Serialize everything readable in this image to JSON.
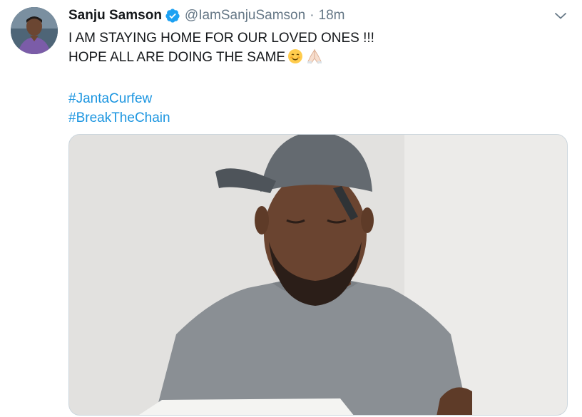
{
  "tweet": {
    "author_name": "Sanju Samson",
    "handle": "@IamSanjuSamson",
    "separator": "·",
    "time": "18m",
    "verified": true,
    "text_line_1": "I AM STAYING HOME FOR OUR LOVED ONES !!!",
    "text_line_2": "HOPE ALL ARE DOING THE SAME",
    "emojis": [
      "smiling-face-icon",
      "folded-hands-icon"
    ],
    "hashtags": [
      "#JantaCurfew",
      "#BreakTheChain"
    ]
  },
  "colors": {
    "link": "#1b95e0",
    "secondary_text": "#657786",
    "primary_text": "#14171a",
    "verified_badge": "#1da1f2"
  },
  "icons": {
    "verified": "verified-badge-icon",
    "menu": "chevron-down-icon"
  }
}
